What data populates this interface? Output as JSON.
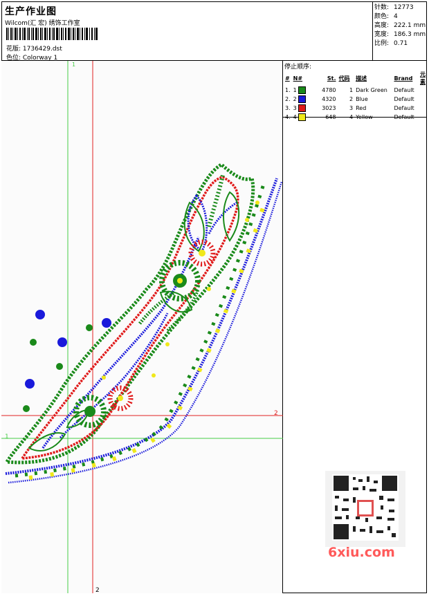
{
  "header": {
    "title": "生产作业图",
    "company": "Wilcom(汇 宏) 绣饰工作室",
    "design_label": "花版: 1736429.dst",
    "color_label": "色位: Colorway 1"
  },
  "stats": [
    {
      "k": "针数:",
      "v": "12773"
    },
    {
      "k": "颜色:",
      "v": "4"
    },
    {
      "k": "高度:",
      "v": "222.1 mm"
    },
    {
      "k": "宽度:",
      "v": "186.3 mm"
    },
    {
      "k": "比例:",
      "v": "0.71"
    }
  ],
  "stop_sequence": {
    "label": "停止顺序:",
    "headers": [
      "#",
      "N#",
      "St.",
      "代码",
      "描述",
      "Brand",
      "元素"
    ],
    "rows": [
      {
        "n": "1.",
        "nn": "1",
        "color": "#1a8a1a",
        "st": "4780",
        "code": "1",
        "desc": "Dark Green",
        "brand": "Default"
      },
      {
        "n": "2.",
        "nn": "2",
        "color": "#1a1adb",
        "st": "4320",
        "code": "2",
        "desc": "Blue",
        "brand": "Default"
      },
      {
        "n": "3.",
        "nn": "3",
        "color": "#e01a1a",
        "st": "3023",
        "code": "3",
        "desc": "Red",
        "brand": "Default"
      },
      {
        "n": "4.",
        "nn": "4",
        "color": "#f0e81a",
        "st": "648",
        "code": "4",
        "desc": "Yellow",
        "brand": "Default"
      }
    ]
  },
  "guides": {
    "v1": "1",
    "v2": "2",
    "h1": "1",
    "h2": "2"
  },
  "logo": "6xiu.com",
  "colors": {
    "green": "#1a8a1a",
    "blue": "#1a1adb",
    "red": "#e01a1a",
    "yellow": "#f0e81a",
    "guide_green": "#44cc44",
    "guide_red": "#e02020"
  }
}
